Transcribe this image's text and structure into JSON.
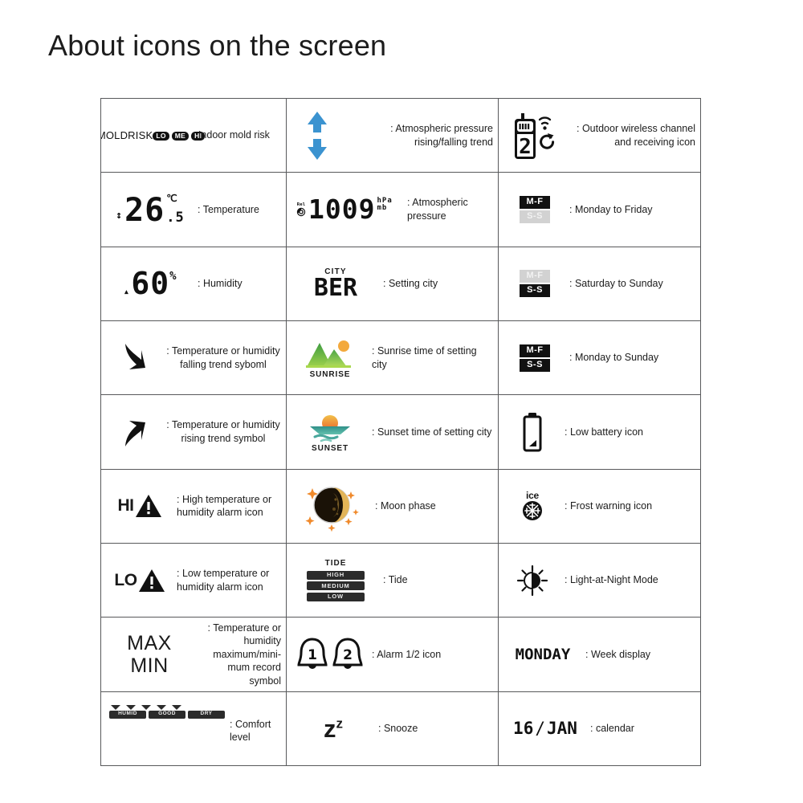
{
  "title": "About icons on the screen",
  "rows": [
    {
      "cells": [
        {
          "icon": "mold-risk-indicator",
          "mold": {
            "line1": "MOLD",
            "line2": "RISK",
            "pills": [
              "LO",
              "ME",
              "HI"
            ]
          },
          "desc": ": Indoor mold risk"
        },
        {
          "icon": "pressure-trend-arrows",
          "desc": ": Atmospheric pressure rising/falling trend",
          "align": "right"
        },
        {
          "icon": "outdoor-wireless-channel",
          "channel": "2",
          "desc": ": Outdoor wireless channel and receiving icon",
          "align": "right"
        }
      ]
    },
    {
      "cells": [
        {
          "icon": "temperature-reading",
          "temp": {
            "value": "26",
            "unit": "℃",
            "decimal": ".5"
          },
          "desc": ": Temperature"
        },
        {
          "icon": "atmospheric-pressure-reading",
          "pressure": {
            "rel": "Rel",
            "value": "1009",
            "unit1": "hPa",
            "unit2": "mb"
          },
          "desc": ": Atmospheric pressure"
        },
        {
          "icon": "weekday-badge-mf",
          "badges": {
            "top": "M-F",
            "bottom": "S-S",
            "top_on": true,
            "bottom_on": false
          },
          "desc": ": Monday to Friday"
        }
      ]
    },
    {
      "cells": [
        {
          "icon": "humidity-reading",
          "humidity": {
            "value": "60",
            "unit": "%"
          },
          "desc": ": Humidity"
        },
        {
          "icon": "setting-city-display",
          "city": {
            "label": "CITY",
            "value": "BER"
          },
          "desc": ": Setting  city"
        },
        {
          "icon": "weekday-badge-ss",
          "badges": {
            "top": "M-F",
            "bottom": "S-S",
            "top_on": false,
            "bottom_on": true
          },
          "desc": ": Saturday to Sunday"
        }
      ]
    },
    {
      "cells": [
        {
          "icon": "falling-trend-arrow",
          "desc": ": Temperature or humidity falling trend syboml",
          "align": "center"
        },
        {
          "icon": "sunrise-icon",
          "sun": {
            "label": "SUNRISE"
          },
          "desc": ": Sunrise time of setting city"
        },
        {
          "icon": "weekday-badge-all",
          "badges": {
            "top": "M-F",
            "bottom": "S-S",
            "top_on": true,
            "bottom_on": true
          },
          "desc": ": Monday to Sunday"
        }
      ]
    },
    {
      "cells": [
        {
          "icon": "rising-trend-arrow",
          "desc": ": Temperature or humidity rising trend symbol",
          "align": "center"
        },
        {
          "icon": "sunset-icon",
          "sun": {
            "label": "SUNSET"
          },
          "desc": ": Sunset time of setting city"
        },
        {
          "icon": "low-battery-icon",
          "desc": ": Low battery icon"
        }
      ]
    },
    {
      "cells": [
        {
          "icon": "high-alarm-icon",
          "hl": "HI",
          "desc": ": High temperature or humidity alarm icon"
        },
        {
          "icon": "moon-phase-icon",
          "desc": ": Moon phase"
        },
        {
          "icon": "frost-warning-icon",
          "ice_label": "ice",
          "desc": ": Frost warning icon"
        }
      ]
    },
    {
      "cells": [
        {
          "icon": "low-alarm-icon",
          "hl": "LO",
          "desc": ": Low temperature or humidity alarm icon"
        },
        {
          "icon": "tide-indicator",
          "tide": {
            "title": "TIDE",
            "levels": [
              "HIGH",
              "MEDIUM",
              "LOW"
            ]
          },
          "desc": ": Tide"
        },
        {
          "icon": "light-at-night-icon",
          "desc": ": Light-at-Night Mode"
        }
      ]
    },
    {
      "cells": [
        {
          "icon": "max-min-record-symbol",
          "maxmin": {
            "line1": "MAX",
            "line2": "MIN"
          },
          "desc": ": Temperature or humidity maximum/mini-mum record symbol",
          "align": "right"
        },
        {
          "icon": "alarm-bells-icon",
          "bells": [
            "1",
            "2"
          ],
          "desc": ": Alarm 1/2 icon"
        },
        {
          "icon": "week-display",
          "week": "MONDAY",
          "desc": ": Week display"
        }
      ]
    },
    {
      "cells": [
        {
          "icon": "comfort-level-indicator",
          "comfort": {
            "bars": [
              "HUMID",
              "GOOD",
              "DRY"
            ],
            "markers": 5
          },
          "desc": ": Comfort level"
        },
        {
          "icon": "snooze-icon",
          "snooze": {
            "z1": "z",
            "z2": "z"
          },
          "desc": ": Snooze"
        },
        {
          "icon": "calendar-display",
          "calendar": {
            "day": "16",
            "sep": "/",
            "month": "JAN"
          },
          "desc": ": calendar"
        }
      ]
    }
  ],
  "colors": {
    "arrow_blue": "#3b93d0",
    "ink": "#1c1c1c",
    "border": "#58595b",
    "badge_on": "#111111",
    "badge_off": "#d2d2d2"
  }
}
